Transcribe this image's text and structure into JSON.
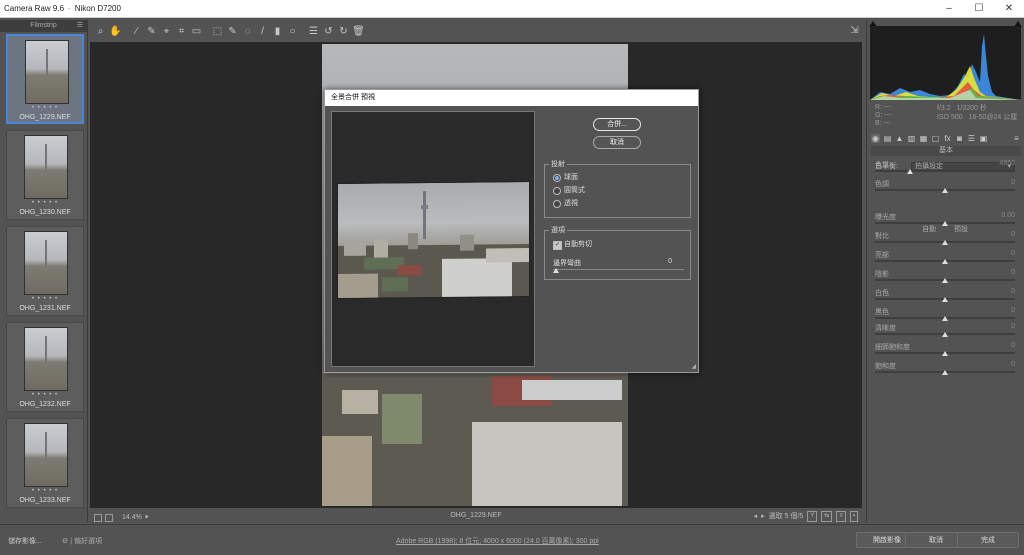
{
  "window": {
    "app_title": "Camera Raw 9.6",
    "separator": "-",
    "camera": "Nikon D7200"
  },
  "filmstrip": {
    "title": "Filmstrip",
    "items": [
      {
        "stars": "• • • • •",
        "filename": "OHG_1229.NEF",
        "selected": true
      },
      {
        "stars": "• • • • •",
        "filename": "OHG_1230.NEF",
        "selected": false
      },
      {
        "stars": "• • • • •",
        "filename": "OHG_1231.NEF",
        "selected": false
      },
      {
        "stars": "• • • • •",
        "filename": "OHG_1232.NEF",
        "selected": false
      },
      {
        "stars": "• • • • •",
        "filename": "OHG_1233.NEF",
        "selected": false
      }
    ]
  },
  "toolbar": {
    "icons": [
      "zoom-icon",
      "hand-icon",
      "white-balance-icon",
      "color-sampler-icon",
      "targeted-adjust-icon",
      "crop-icon",
      "straighten-icon",
      "transform-icon",
      "spot-removal-icon",
      "red-eye-icon",
      "adjustment-brush-icon",
      "graduated-filter-icon",
      "radial-filter-icon",
      "preferences-icon",
      "rotate-ccw-icon",
      "rotate-cw-icon",
      "trash-icon"
    ],
    "glyphs": [
      "⌕",
      "✋",
      "⁄",
      "✎",
      "⌖",
      "⌗",
      "▭",
      "⬚",
      "✎",
      "◌",
      "/",
      "▮",
      "○",
      "☰",
      "↺",
      "↻",
      "🗑"
    ],
    "fullscreen_glyph": "⇲"
  },
  "canvas": {
    "zoom": "14.4%",
    "filename": "OHG_1229.NEF",
    "nav_text": "選取 5 個/5"
  },
  "histogram": {
    "rgb_labels": [
      "R:",
      "G:",
      "B:"
    ],
    "rgb_values": [
      "---",
      "---",
      "---"
    ],
    "aperture": "f/3.2",
    "shutter": "1/3200 秒",
    "iso": "ISO 500",
    "lens": "16-50@24 公厘"
  },
  "panel": {
    "section_title": "基本",
    "white_balance_label": "白平衡:",
    "white_balance_value": "拍攝設定",
    "auto_label": "自動",
    "default_label": "預設",
    "sliders_top": [
      {
        "label": "色溫",
        "value": "4950",
        "pos": 25
      },
      {
        "label": "色調",
        "value": "0",
        "pos": 50
      }
    ],
    "sliders_basic": [
      {
        "label": "曝光度",
        "value": "0.00",
        "pos": 50
      },
      {
        "label": "對比",
        "value": "0",
        "pos": 50
      },
      {
        "label": "亮部",
        "value": "0",
        "pos": 50
      },
      {
        "label": "陰影",
        "value": "0",
        "pos": 50
      },
      {
        "label": "白色",
        "value": "0",
        "pos": 50
      },
      {
        "label": "黑色",
        "value": "0",
        "pos": 50
      }
    ],
    "sliders_presence": [
      {
        "label": "清晰度",
        "value": "0",
        "pos": 50
      },
      {
        "label": "細節飽和度",
        "value": "0",
        "pos": 50
      },
      {
        "label": "飽和度",
        "value": "0",
        "pos": 50
      }
    ]
  },
  "bottom": {
    "save_label": "儲存影像...",
    "workflow_link": "Adobe RGB (1998); 8 位元; 4000 x 6000 (24.0 百萬像素); 300 ppi",
    "open_label": "開啟影像",
    "cancel_label": "取消",
    "done_label": "完成",
    "gear_link": "| 偏好選項"
  },
  "dialog": {
    "title": "全景合併 預視",
    "merge_button": "合併...",
    "cancel_button": "取消",
    "projection_label": "投射",
    "projection_options": [
      {
        "label": "球面",
        "selected": true
      },
      {
        "label": "圓筒式",
        "selected": false
      },
      {
        "label": "透視",
        "selected": false
      }
    ],
    "options_label": "選項",
    "auto_crop_label": "自動剪切",
    "boundary_warp_label": "邊界彎曲",
    "boundary_warp_value": "0",
    "boundary_warp_fraction": 0
  }
}
